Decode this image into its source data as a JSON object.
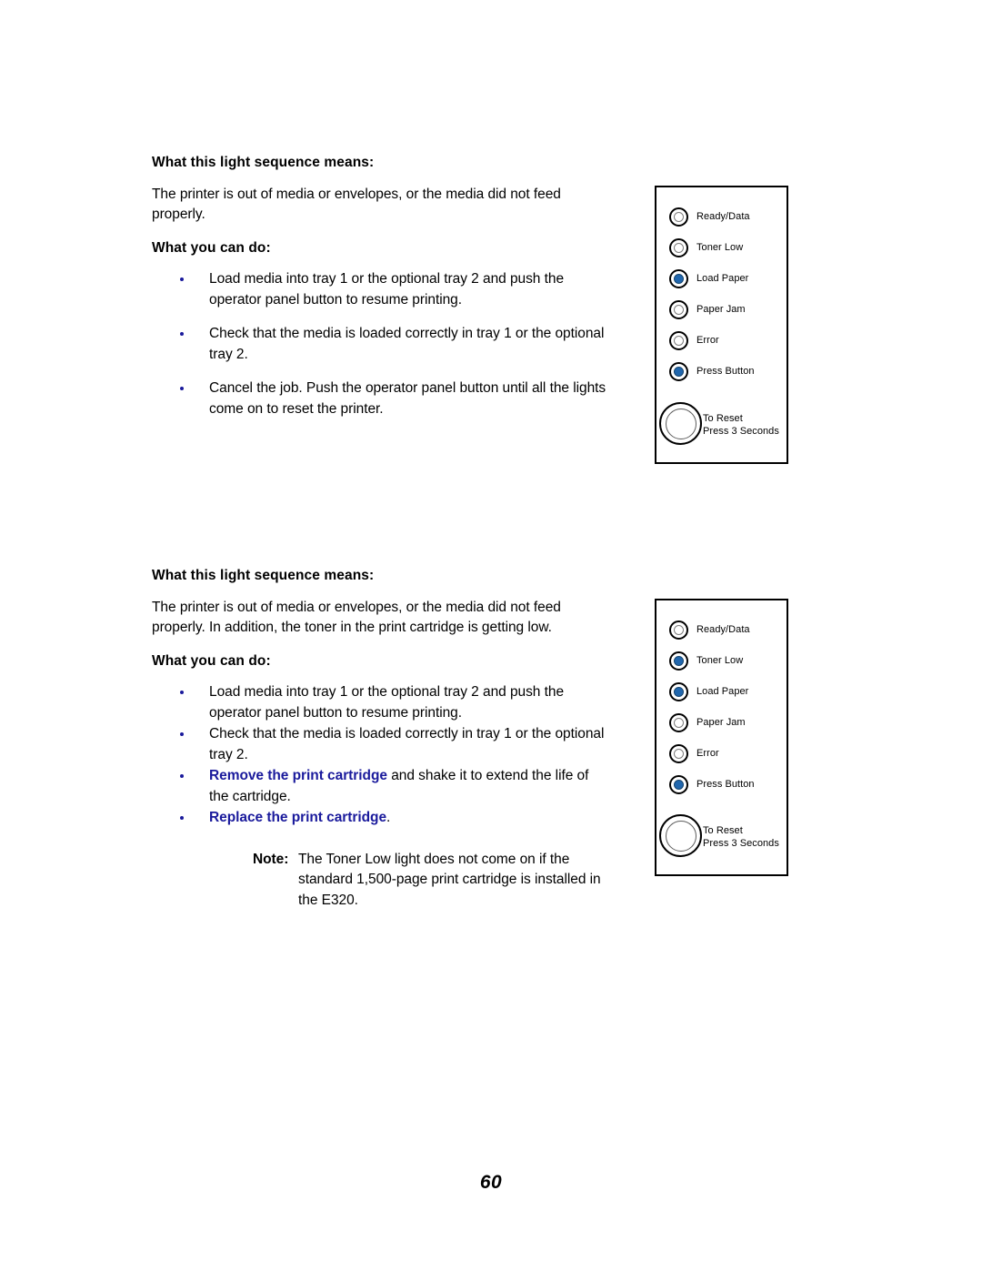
{
  "document": {
    "page_number": "60"
  },
  "colors": {
    "link": "#1a1a9c",
    "led_on": "#2167ae",
    "bullet": "#1a1a9c",
    "panel_border": "#000000"
  },
  "sections": [
    {
      "heading_means": "What this light sequence means:",
      "description": "The printer is out of media or envelopes, or the media did not feed properly.",
      "heading_do": "What you can do:",
      "bullets": [
        {
          "text": "Load media into tray 1 or the optional tray 2 and push the operator panel button to resume printing."
        },
        {
          "text": "Check that the media is loaded correctly in tray 1 or the optional tray 2."
        },
        {
          "text": "Cancel the job. Push the operator panel button until all the lights come on to reset the printer."
        }
      ]
    },
    {
      "heading_means": "What this light sequence means:",
      "description": "The printer is out of media or envelopes, or the media did not feed properly. In addition, the toner in the print cartridge is getting low.",
      "heading_do": "What you can do:",
      "bullets": [
        {
          "text": "Load media into tray 1 or the optional tray 2 and push the operator panel button to resume printing."
        },
        {
          "text": "Check that the media is loaded correctly in tray 1 or the optional tray 2."
        },
        {
          "link_text": "Remove the print cartridge",
          "text": " and shake it to extend the life of the cartridge."
        },
        {
          "link_text": "Replace the print cartridge",
          "text": "."
        }
      ],
      "note": {
        "label": "Note:",
        "text": "The Toner Low light does not come on if the standard 1,500-page print cartridge is installed in the E320."
      }
    }
  ],
  "panels": [
    {
      "leds": [
        {
          "label": "Ready/Data",
          "state": "off"
        },
        {
          "label": "Toner Low",
          "state": "off"
        },
        {
          "label": "Load Paper",
          "state": "on"
        },
        {
          "label": "Paper Jam",
          "state": "off"
        },
        {
          "label": "Error",
          "state": "off"
        },
        {
          "label": "Press Button",
          "state": "on"
        }
      ],
      "reset": {
        "line1": "To Reset",
        "line2": "Press 3 Seconds"
      }
    },
    {
      "leds": [
        {
          "label": "Ready/Data",
          "state": "off"
        },
        {
          "label": "Toner Low",
          "state": "on"
        },
        {
          "label": "Load Paper",
          "state": "on"
        },
        {
          "label": "Paper Jam",
          "state": "off"
        },
        {
          "label": "Error",
          "state": "off"
        },
        {
          "label": "Press Button",
          "state": "on"
        }
      ],
      "reset": {
        "line1": "To Reset",
        "line2": "Press 3 Seconds"
      }
    }
  ]
}
